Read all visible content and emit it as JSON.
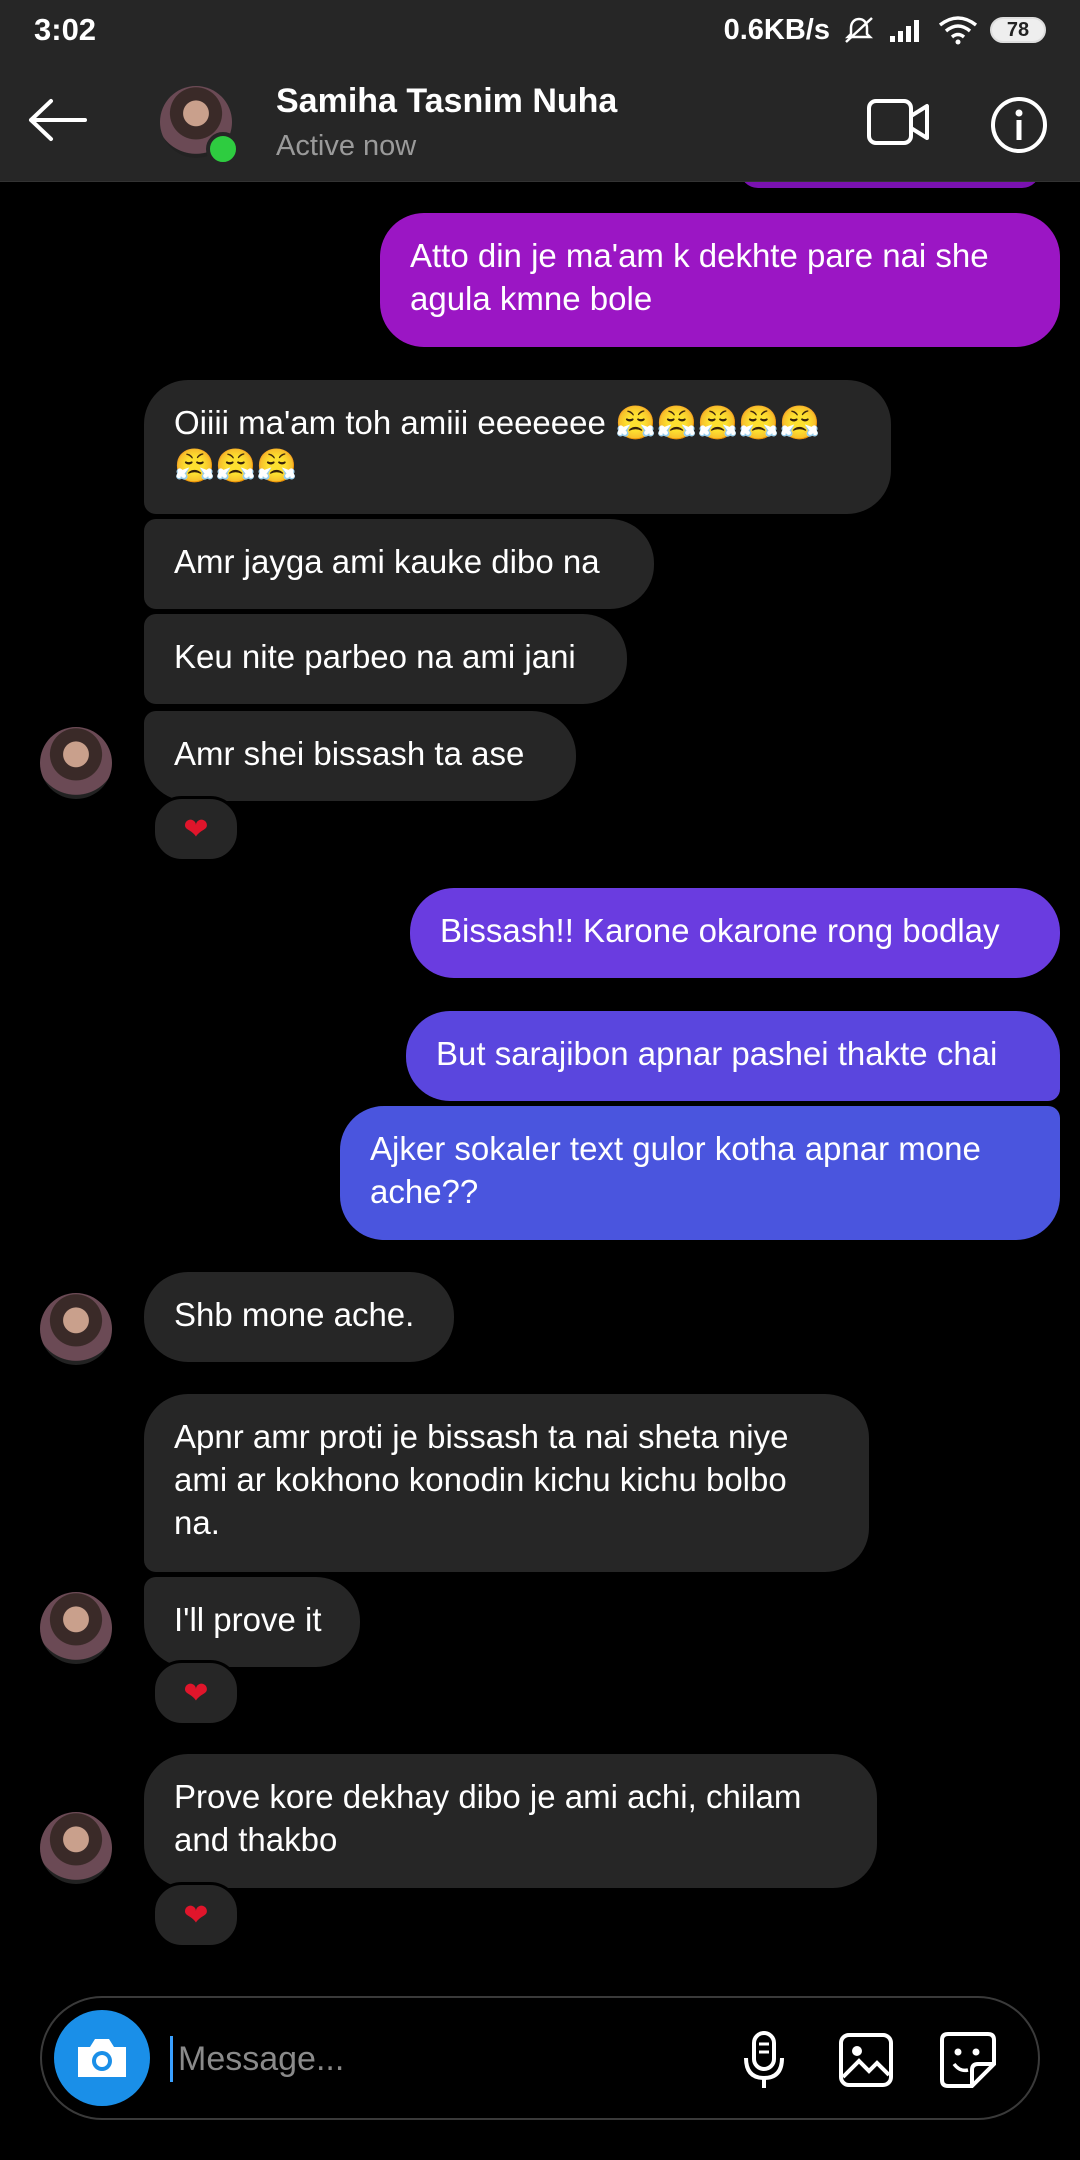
{
  "status_bar": {
    "time": "3:02",
    "network_speed": "0.6KB/s",
    "battery": "78"
  },
  "header": {
    "contact_name": "Samiha Tasnim Nuha",
    "contact_status": "Active now"
  },
  "messages": [
    {
      "dir": "out",
      "text": "Atto din je ma'am k dekhte pare nai she agula kmne bole"
    },
    {
      "dir": "in",
      "text": "Oiiii ma'am toh amiii eeeeeee 😤😤😤😤😤😤😤😤"
    },
    {
      "dir": "in",
      "text": "Amr jayga ami kauke dibo na"
    },
    {
      "dir": "in",
      "text": "Keu nite parbeo na ami jani"
    },
    {
      "dir": "in",
      "text": "Amr shei bissash ta ase",
      "reaction": "❤"
    },
    {
      "dir": "out",
      "text": "Bissash!! Karone okarone rong bodlay"
    },
    {
      "dir": "out",
      "text": "But sarajibon apnar pashei thakte chai"
    },
    {
      "dir": "out",
      "text": "Ajker sokaler text gulor kotha apnar mone ache??"
    },
    {
      "dir": "in",
      "text": "Shb mone ache."
    },
    {
      "dir": "in",
      "text": "Apnr amr proti je bissash ta nai sheta niye ami ar kokhono konodin kichu kichu bolbo na."
    },
    {
      "dir": "in",
      "text": "I'll prove it",
      "reaction": "❤"
    },
    {
      "dir": "in",
      "text": "Prove kore dekhay dibo je ami achi, chilam and thakbo",
      "reaction": "❤"
    }
  ],
  "composer": {
    "placeholder": "Message..."
  },
  "colors": {
    "header_bg": "#262626",
    "incoming_bubble": "#262626",
    "outgoing_purple": "#9b16c4",
    "outgoing_violet": "#6a3ce0",
    "outgoing_blue": "#4a55de",
    "online": "#2ecc40",
    "camera_button": "#1a8fe8",
    "heart": "#e0152b"
  },
  "icons": [
    "back-arrow-icon",
    "video-call-icon",
    "info-icon",
    "camera-icon",
    "microphone-icon",
    "gallery-icon",
    "sticker-icon",
    "heart-icon",
    "mute-icon",
    "signal-icon",
    "wifi-icon",
    "battery-icon"
  ]
}
